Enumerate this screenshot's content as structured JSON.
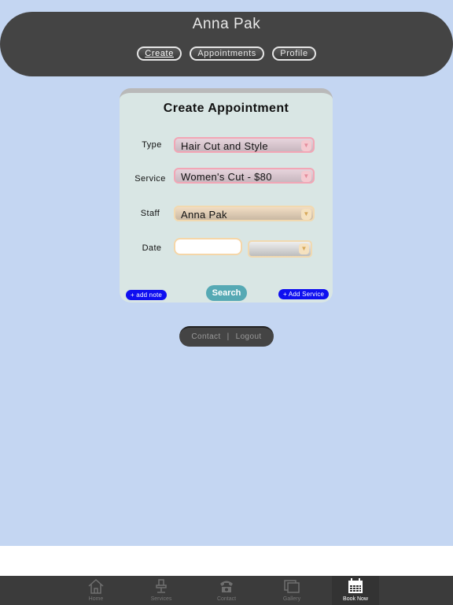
{
  "header": {
    "title": "Anna Pak",
    "nav": [
      "Create",
      "Appointments",
      "Profile"
    ]
  },
  "card": {
    "title": "Create Appointment",
    "type_label": "Type",
    "type_value": "Hair Cut and Style",
    "service_label": "Service",
    "service_value": "Women's Cut - $80",
    "staff_label": "Staff",
    "staff_value": "Anna Pak",
    "date_label": "Date",
    "date_value": "",
    "time_value": "",
    "add_note": "+ add note",
    "search": "Search",
    "add_service": "+ Add Service"
  },
  "footer_links": {
    "contact": "Contact",
    "separator": "|",
    "logout": "Logout"
  },
  "tabbar": {
    "tabs": [
      {
        "label": "Home",
        "icon": "home-icon"
      },
      {
        "label": "Services",
        "icon": "salon-chair-icon"
      },
      {
        "label": "Contact",
        "icon": "telephone-icon"
      },
      {
        "label": "Gallery",
        "icon": "gallery-icon"
      },
      {
        "label": "Book Now",
        "icon": "calendar-icon"
      }
    ],
    "active": "Book Now"
  },
  "colors": {
    "background": "#c4d6f2",
    "header": "#444444",
    "accent_blue": "#0f0ff0",
    "search_button": "#56a9b4"
  }
}
